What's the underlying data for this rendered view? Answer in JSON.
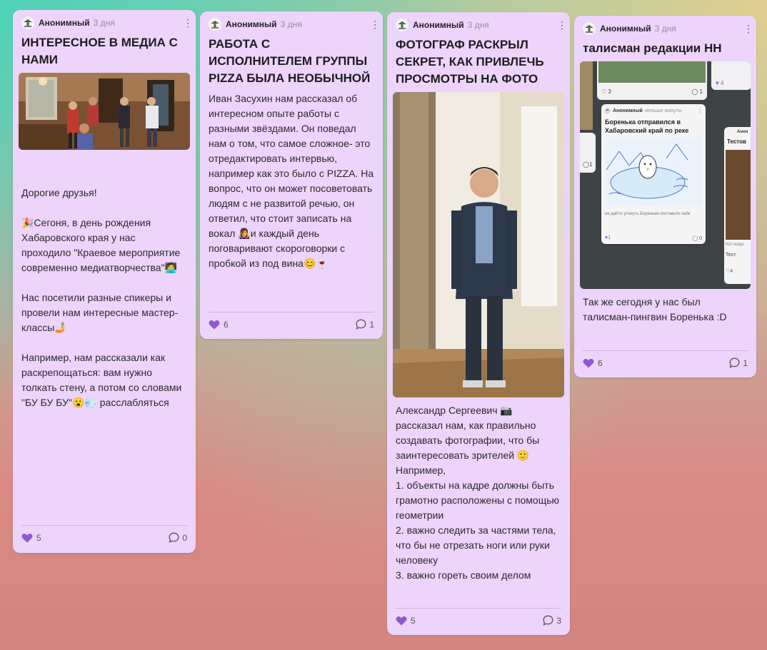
{
  "colors": {
    "card_bg": "#ecd4fb",
    "heart": "#8e57d6",
    "divider": "#cbb3da"
  },
  "posts": [
    {
      "author": "Анонимный",
      "time": "3 дня",
      "title": "ИНТЕРЕСНОЕ В МЕДИА С НАМИ",
      "body": "Дорогие друзья!\n\n🎉Сегоня, в день рождения Хабаровского края у нас проходило \"Краевое мероприятие современно медиатворчества\"🧑‍💻\n\nНас посетили разные спикеры и провели нам интересные мастер-классы🤳\n\nНапример, нам рассказали как раскрепощаться: вам нужно толкать стену, а потом со словами \"БУ БУ БУ\"😮💨 расслабляться",
      "likes": "5",
      "comments": "0"
    },
    {
      "author": "Анонимный",
      "time": "3 дня",
      "title": "РАБОТА С ИСПОЛНИТЕЛЕМ ГРУППЫ PIZZA БЫЛА НЕОБЫЧНОЙ",
      "body": "Иван Засухин нам рассказал об интересном опыте работы с разными звёздами. Он поведал нам о том, что самое сложное- это отредактировать интервью, например как это было с PIZZA. На вопрос, что он может посоветовать людям с не развитой речью, он ответил, что стоит записать на вокал 👩‍🎤и каждый день поговаривают скороговорки с пробкой из под вина😊🍷",
      "likes": "6",
      "comments": "1"
    },
    {
      "author": "Анонимный",
      "time": "3 дня",
      "title": "ФОТОГРАФ РАСКРЫЛ СЕКРЕТ, КАК ПРИВЛЕЧЬ ПРОСМОТРЫ НА ФОТО",
      "body": "Александр Сергеевич 📷 рассказал нам, как правильно создавать фотографии, что бы заинтересовать зрителей 🙂\nНапример,\n1. объекты на кадре должны быть грамотно расположены с помощью геометрии\n2. важно следить за частями тела, что бы не отрезать ноги или руки человеку\n3. важно гореть своим делом",
      "likes": "5",
      "comments": "3"
    },
    {
      "author": "Анонимный",
      "time": "3 дня",
      "title": "талисман редакции НН",
      "body": "Так же сегодня у нас был талисман-пингвин Боренька :D",
      "likes": "6",
      "comments": "1",
      "screenshot": {
        "author": "Анонимный",
        "time": "меньше минуты",
        "title": "Боренька отправился в Хабаровский край по реке",
        "caption": "не дайте утонуть Бореньке-поставьте лайк",
        "likes": "1",
        "comments": "0",
        "top_likes": "3",
        "top_comments": "1",
        "top_right_likes": "4",
        "left_comments": "1",
        "right_author": "Анон",
        "right_title": "Тестов",
        "right_text1": "Кот искус",
        "right_text2": "Тест",
        "right_likes": "4"
      }
    }
  ]
}
